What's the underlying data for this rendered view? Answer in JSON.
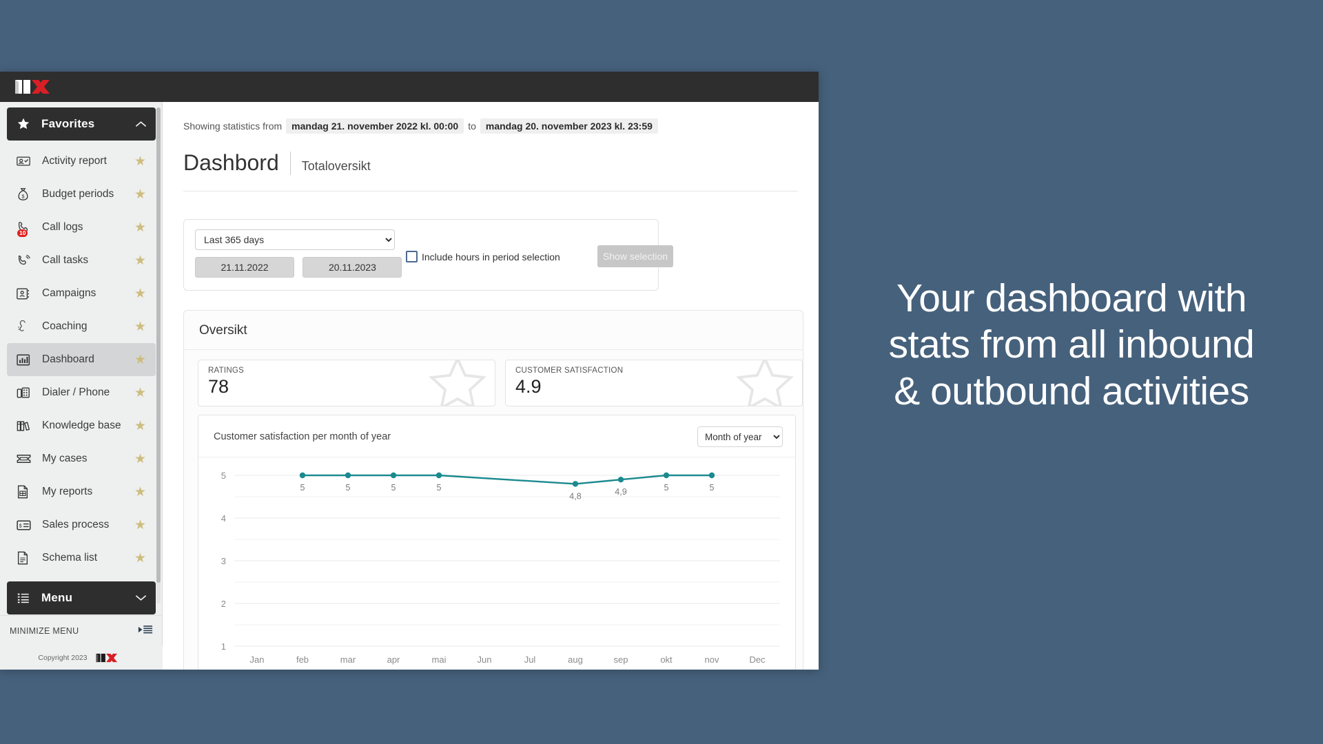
{
  "brand": {
    "logo_text": "ITX",
    "logo_white": "IT",
    "logo_red": "X",
    "red": "#d81f26",
    "dark": "#2e2e2e"
  },
  "sidebar": {
    "favorites_header": {
      "label": "Favorites",
      "icon": "star-icon",
      "chevron": "chevron-up-icon"
    },
    "items": [
      {
        "label": "Activity report",
        "icon": "activity-report-icon",
        "star": "★",
        "badge": ""
      },
      {
        "label": "Budget periods",
        "icon": "money-bag-icon",
        "star": "★",
        "badge": ""
      },
      {
        "label": "Call logs",
        "icon": "call-log-icon",
        "star": "★",
        "badge": "10"
      },
      {
        "label": "Call tasks",
        "icon": "phone-ring-icon",
        "star": "★",
        "badge": ""
      },
      {
        "label": "Campaigns",
        "icon": "contact-card-icon",
        "star": "★",
        "badge": ""
      },
      {
        "label": "Coaching",
        "icon": "ear-listen-icon",
        "star": "★",
        "badge": ""
      },
      {
        "label": "Dashboard",
        "icon": "bar-chart-icon",
        "star": "★",
        "badge": "",
        "active": true
      },
      {
        "label": "Dialer / Phone",
        "icon": "desk-phone-icon",
        "star": "★",
        "badge": ""
      },
      {
        "label": "Knowledge base",
        "icon": "books-icon",
        "star": "★",
        "badge": ""
      },
      {
        "label": "My cases",
        "icon": "ticket-icon",
        "star": "★",
        "badge": ""
      },
      {
        "label": "My reports",
        "icon": "report-doc-icon",
        "star": "★",
        "badge": ""
      },
      {
        "label": "Sales process",
        "icon": "invoice-icon",
        "star": "★",
        "badge": ""
      },
      {
        "label": "Schema list",
        "icon": "document-icon",
        "star": "★",
        "badge": ""
      }
    ],
    "menu_header": {
      "label": "Menu",
      "icon": "list-icon",
      "chevron": "chevron-down-icon"
    },
    "minimize": {
      "label": "MINIMIZE MENU",
      "icon": "collapse-menu-icon"
    },
    "copyright": "Copyright 2023"
  },
  "header": {
    "stats_prefix": "Showing statistics from",
    "date_from": "mandag 21. november 2022 kl. 00:00",
    "stats_mid": "to",
    "date_to": "mandag 20. november 2023 kl. 23:59",
    "title": "Dashbord",
    "subtitle": "Totaloversikt"
  },
  "date_panel": {
    "period_selected": "Last 365 days",
    "period_options": [
      "Last 365 days"
    ],
    "from_date": "21.11.2022",
    "to_date": "20.11.2023",
    "include_hours_label": "Include hours in period selection",
    "include_hours_checked": false,
    "show_selection_label": "Show selection"
  },
  "overview": {
    "title": "Oversikt",
    "kpis": [
      {
        "label": "RATINGS",
        "value": "78",
        "watermark": "star-outline"
      },
      {
        "label": "CUSTOMER SATISFACTION",
        "value": "4.9",
        "watermark": "star-outline"
      }
    ]
  },
  "chart_card": {
    "title": "Customer satisfaction per month of year",
    "metric_selected": "Month of year",
    "metric_options": [
      "Month of year"
    ]
  },
  "chart_data": {
    "type": "line",
    "title": "Customer satisfaction per month of year",
    "xlabel": "",
    "ylabel": "",
    "categories": [
      "Jan",
      "feb",
      "mar",
      "apr",
      "mai",
      "Jun",
      "Jul",
      "aug",
      "sep",
      "okt",
      "nov",
      "Dec"
    ],
    "series": [
      {
        "name": "Customer satisfaction",
        "color": "#1b8a8f",
        "values": [
          null,
          5,
          5,
          5,
          5,
          null,
          null,
          4.8,
          4.9,
          5,
          5,
          null
        ],
        "point_labels": [
          "",
          "5",
          "5",
          "5",
          "5",
          "",
          "",
          "4,8",
          "4,9",
          "5",
          "5",
          ""
        ]
      }
    ],
    "ylim": [
      1,
      5
    ],
    "yticks": [
      1,
      2,
      3,
      4,
      5
    ],
    "ytick_labels": [
      "1",
      "2",
      "3",
      "4",
      "5"
    ],
    "minor_gridlines": true,
    "grid": true,
    "legend": false
  },
  "caption": {
    "line1": "Your dashboard with",
    "line2": "stats from all inbound",
    "line3": "& outbound activities"
  },
  "colors": {
    "page_bg": "#46617c",
    "accent_teal": "#1b8a8f",
    "star_gold": "#cdbd7e",
    "badge_red": "#e02020"
  }
}
